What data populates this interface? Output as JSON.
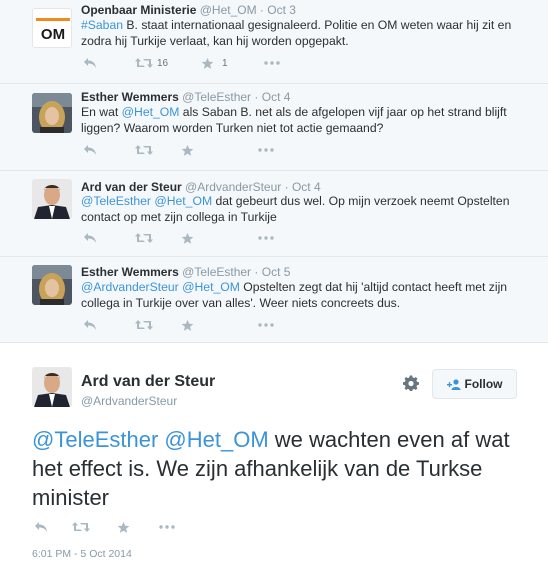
{
  "tweets": [
    {
      "name": "Openbaar Ministerie",
      "handle": "@Het_OM",
      "sep": "·",
      "date": "Oct 3",
      "text_parts": [
        {
          "t": "#Saban",
          "link": true
        },
        {
          "t": " B. staat internationaal gesignaleerd. Politie en OM weten waar hij zit en zodra hij Turkije verlaat, kan hij worden opgepakt.",
          "link": false
        }
      ],
      "retweet_count": "16",
      "favorite_count": "1"
    },
    {
      "name": "Esther Wemmers",
      "handle": "@TeleEsther",
      "sep": "·",
      "date": "Oct 4",
      "text_parts": [
        {
          "t": "En wat ",
          "link": false
        },
        {
          "t": "@Het_OM",
          "link": true
        },
        {
          "t": " als Saban B. net als de afgelopen vijf jaar op het strand blijft liggen? Waarom worden Turken niet tot actie gemaand?",
          "link": false
        }
      ],
      "retweet_count": "",
      "favorite_count": ""
    },
    {
      "name": "Ard van der Steur",
      "handle": "@ArdvanderSteur",
      "sep": "·",
      "date": "Oct 4",
      "text_parts": [
        {
          "t": "@TeleEsther",
          "link": true
        },
        {
          "t": " ",
          "link": false
        },
        {
          "t": "@Het_OM",
          "link": true
        },
        {
          "t": " dat gebeurt dus wel. Op mijn verzoek neemt Opstelten contact op met zijn collega in Turkije",
          "link": false
        }
      ],
      "retweet_count": "",
      "favorite_count": ""
    },
    {
      "name": "Esther Wemmers",
      "handle": "@TeleEsther",
      "sep": "·",
      "date": "Oct 5",
      "text_parts": [
        {
          "t": "@ArdvanderSteur",
          "link": true
        },
        {
          "t": " ",
          "link": false
        },
        {
          "t": "@Het_OM",
          "link": true
        },
        {
          "t": " Opstelten zegt dat hij 'altijd contact heeft met zijn collega in Turkije over van alles'. Weer niets concreets dus.",
          "link": false
        }
      ],
      "retweet_count": "",
      "favorite_count": ""
    }
  ],
  "main_tweet": {
    "name": "Ard van der Steur",
    "handle": "@ArdvanderSteur",
    "follow_label": "Follow",
    "text_parts": [
      {
        "t": "@TeleEsther",
        "link": true
      },
      {
        "t": " ",
        "link": false
      },
      {
        "t": "@Het_OM",
        "link": true
      },
      {
        "t": " we wachten even af wat het effect is. We zijn afhankelijk van de Turkse minister",
        "link": false
      }
    ],
    "timestamp": "6:01 PM - 5 Oct 2014"
  },
  "icons": {
    "reply": "reply-icon",
    "retweet": "retweet-icon",
    "favorite": "star-icon",
    "more": "more-icon",
    "gear": "gear-icon",
    "follow": "follow-user-icon"
  },
  "colors": {
    "link": "#3b94d9",
    "icon": "#aab8c2",
    "om_orange": "#f08a1c"
  }
}
